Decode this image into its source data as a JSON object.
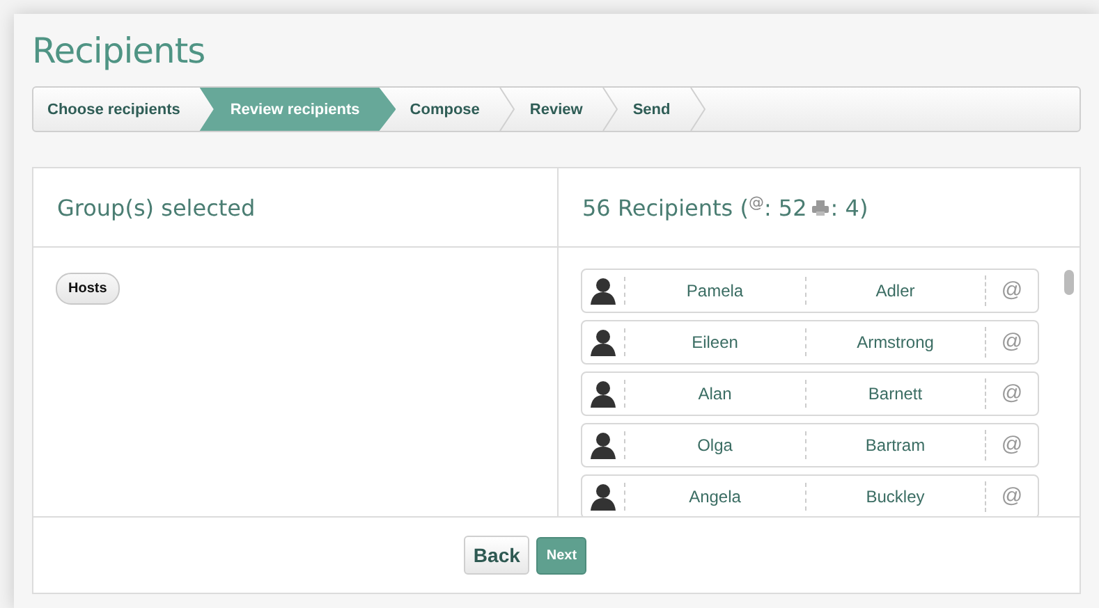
{
  "title": "Recipients",
  "steps": [
    {
      "label": "Choose recipients",
      "selected": false
    },
    {
      "label": "Review recipients",
      "selected": true
    },
    {
      "label": "Compose",
      "selected": false
    },
    {
      "label": "Review",
      "selected": false
    },
    {
      "label": "Send",
      "selected": false
    }
  ],
  "groups_panel": {
    "heading": "Group(s) selected",
    "groups": [
      "Hosts"
    ]
  },
  "recipients_panel": {
    "prefix": "56 Recipients (",
    "email_symbol": "@",
    "email_count": ": 52",
    "print_count": ": 4)",
    "recipients": [
      {
        "first": "Pamela",
        "last": "Adler",
        "contact": "@"
      },
      {
        "first": "Eileen",
        "last": "Armstrong",
        "contact": "@"
      },
      {
        "first": "Alan",
        "last": "Barnett",
        "contact": "@"
      },
      {
        "first": "Olga",
        "last": "Bartram",
        "contact": "@"
      },
      {
        "first": "Angela",
        "last": "Buckley",
        "contact": "@"
      }
    ]
  },
  "buttons": {
    "back": "Back",
    "next": "Next"
  }
}
